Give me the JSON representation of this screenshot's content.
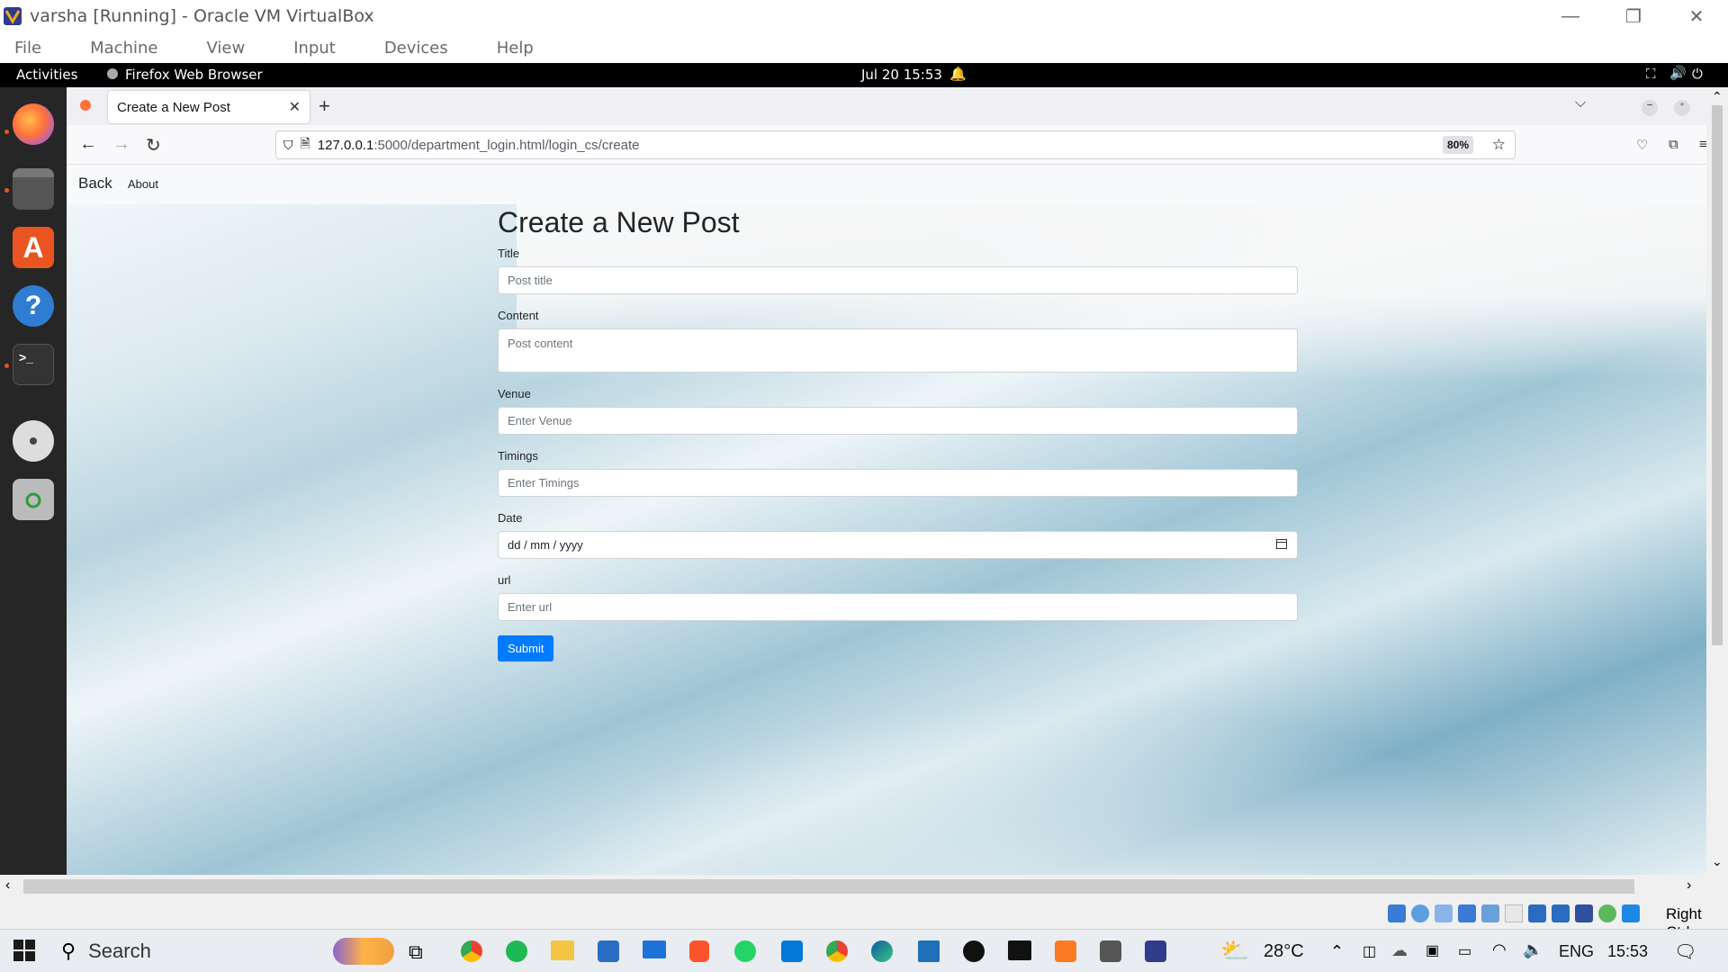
{
  "vbox": {
    "title": "varsha [Running] - Oracle VM VirtualBox",
    "menu": [
      "File",
      "Machine",
      "View",
      "Input",
      "Devices",
      "Help"
    ],
    "host_key": "Right Ctrl"
  },
  "gnome": {
    "activities": "Activities",
    "app_name": "Firefox Web Browser",
    "datetime": "Jul 20  15:53"
  },
  "browser": {
    "tab_title": "Create a New Post",
    "url_host": "127.0.0.1",
    "url_path": ":5000/department_login.html/login_cs/create",
    "zoom": "80%"
  },
  "page": {
    "nav_back": "Back",
    "nav_about": "About",
    "heading": "Create a New Post",
    "fields": {
      "title_label": "Title",
      "title_placeholder": "Post title",
      "content_label": "Content",
      "content_placeholder": "Post content",
      "venue_label": "Venue",
      "venue_placeholder": "Enter Venue",
      "timings_label": "Timings",
      "timings_placeholder": "Enter Timings",
      "date_label": "Date",
      "date_placeholder": "dd / mm / yyyy",
      "url_label": "url",
      "url_placeholder": "Enter url"
    },
    "submit_label": "Submit"
  },
  "taskbar": {
    "search_placeholder": "Search",
    "weather": "28°C",
    "language": "ENG",
    "time": "15:53"
  },
  "colors": {
    "submit_blue": "#007bff",
    "ubuntu_orange": "#e95420",
    "firefox_orange": "#ff7139"
  }
}
